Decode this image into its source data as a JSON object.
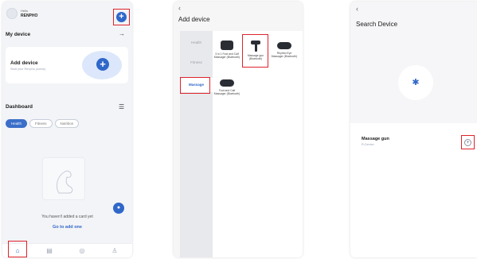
{
  "colors": {
    "accent": "#2f67c9",
    "highlight": "#e0222b"
  },
  "home": {
    "greeting": "Hello",
    "username": "RENPHO",
    "add_icon": "plus-icon",
    "my_device": "My device",
    "add_device_title": "Add device",
    "add_device_sub": "Start your Renpho journey",
    "dashboard": "Dashboard",
    "chips": [
      "Health",
      "Fitness",
      "Nutrition"
    ],
    "empty_text": "You haven't added a card yet",
    "go_link": "Go to add one",
    "tabs": [
      "home-icon",
      "report-icon",
      "discover-icon",
      "profile-icon"
    ]
  },
  "add_device": {
    "back_icon": "chevron-left-icon",
    "title": "Add device",
    "categories": [
      "Health",
      "Fitness",
      "Massage"
    ],
    "devices": [
      "3 in 1 Foot and Calf Massager (Bluetooth)",
      "Massage gun (Bluetooth)",
      "Rhythm Eye Massager (Bluetooth)",
      "Foot and Calf Massager (Bluetooth)"
    ]
  },
  "search_device": {
    "back_icon": "chevron-left-icon",
    "title": "Search Device",
    "bt_icon": "bluetooth-icon",
    "result_name": "Massage gun",
    "result_sub": "R-Device"
  }
}
